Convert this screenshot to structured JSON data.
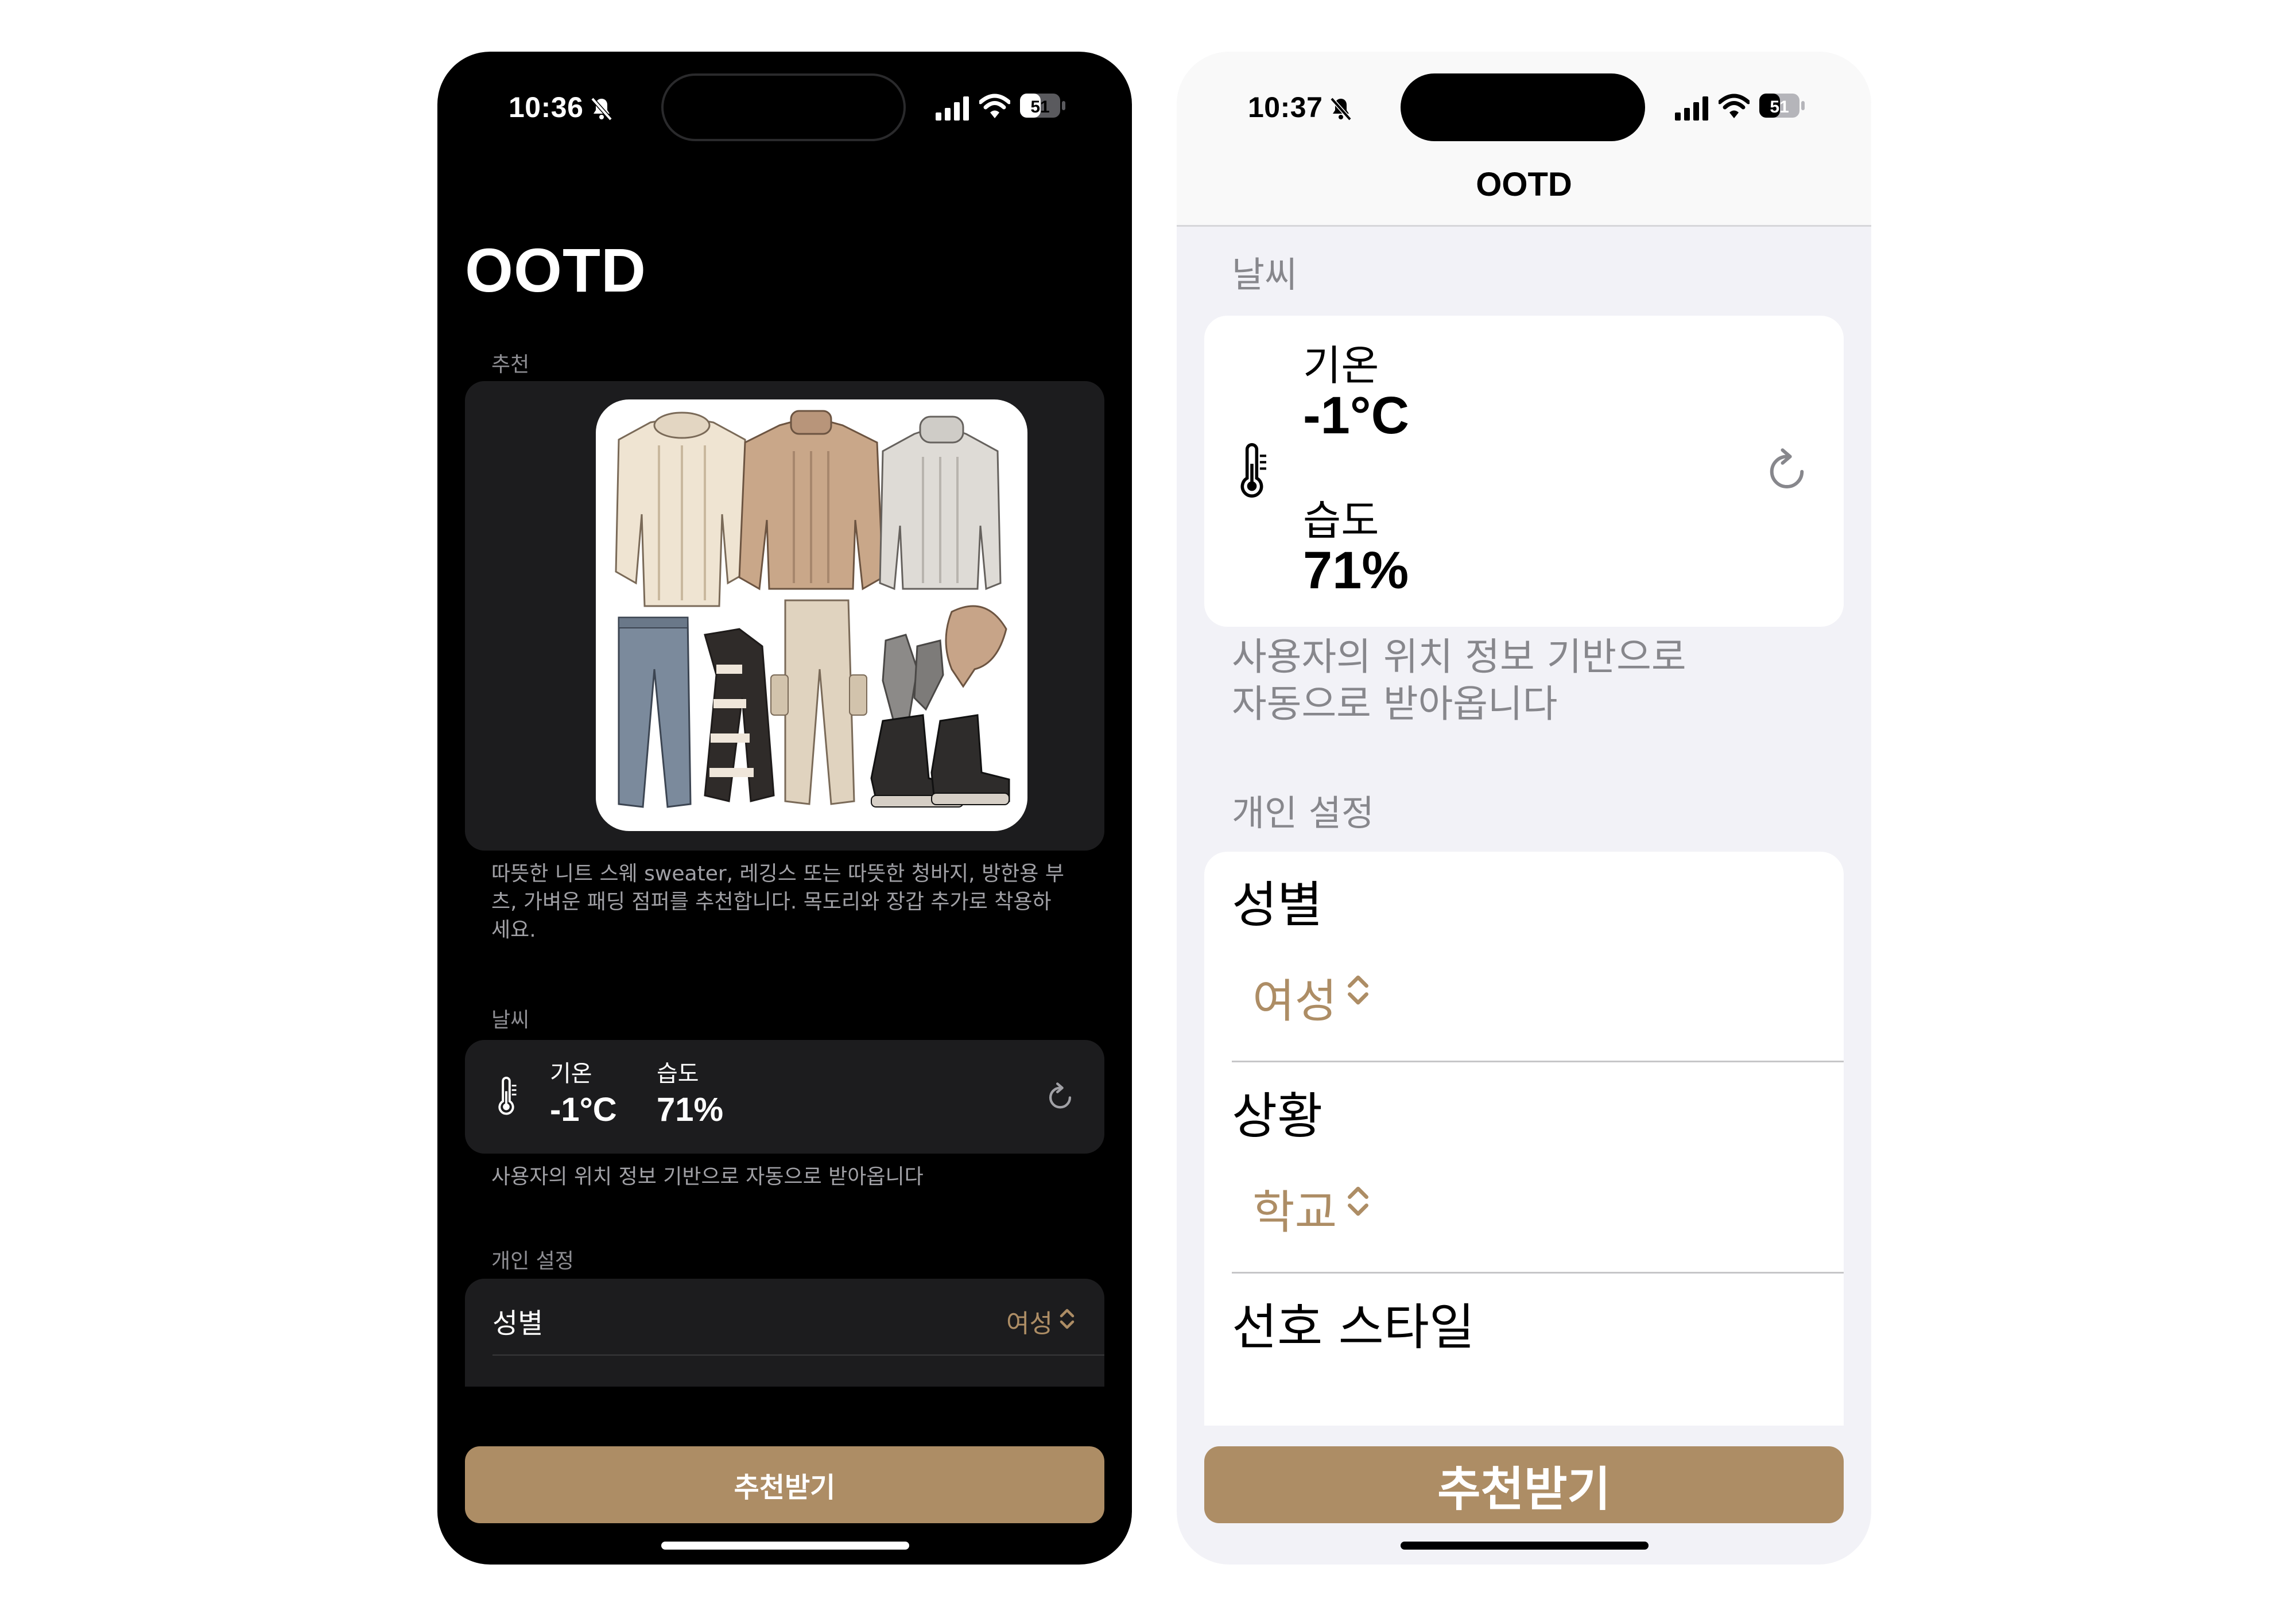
{
  "dark_screen": {
    "status_bar": {
      "time": "10:36",
      "battery": "51"
    },
    "title": "OOTD",
    "recommend_section": "추천",
    "outfit_image_alt": "winter outfit illustration",
    "recommendation_text": "따뜻한 니트 스웨 sweater, 레깅스 또는 따뜻한 청바지, 방한용 부츠, 가벼운 패딩 점퍼를 추천합니다. 목도리와 장갑 추가로 착용하세요.",
    "weather_section": "날씨",
    "temp_label": "기온",
    "temp_value": "-1°C",
    "humidity_label": "습도",
    "humidity_value": "71%",
    "weather_footer": "사용자의 위치 정보 기반으로 자동으로 받아옵니다",
    "settings_section": "개인 설정",
    "gender_label": "성별",
    "gender_value": "여성",
    "button_label": "추천받기"
  },
  "light_screen": {
    "status_bar": {
      "time": "10:37",
      "battery": "51"
    },
    "nav_title": "OOTD",
    "weather_section": "날씨",
    "temp_label": "기온",
    "temp_value": "-1°C",
    "humidity_label": "습도",
    "humidity_value": "71%",
    "weather_footer_line1": "사용자의 위치 정보 기반으로",
    "weather_footer_line2": "자동으로 받아옵니다",
    "settings_section": "개인 설정",
    "gender_label": "성별",
    "gender_value": "여성",
    "situation_label": "상황",
    "situation_value": "학교",
    "style_label": "선호 스타일",
    "button_label": "추천받기"
  },
  "colors": {
    "accent": "#ad8d65",
    "dark_bg": "#000000",
    "dark_card": "#1c1c1e",
    "light_bg": "#f2f2f7",
    "light_card": "#ffffff"
  },
  "icons": [
    "bell-slash-icon",
    "cellular-signal-icon",
    "wifi-icon",
    "battery-icon",
    "thermometer-icon",
    "refresh-icon",
    "chevron-up-down-icon"
  ]
}
